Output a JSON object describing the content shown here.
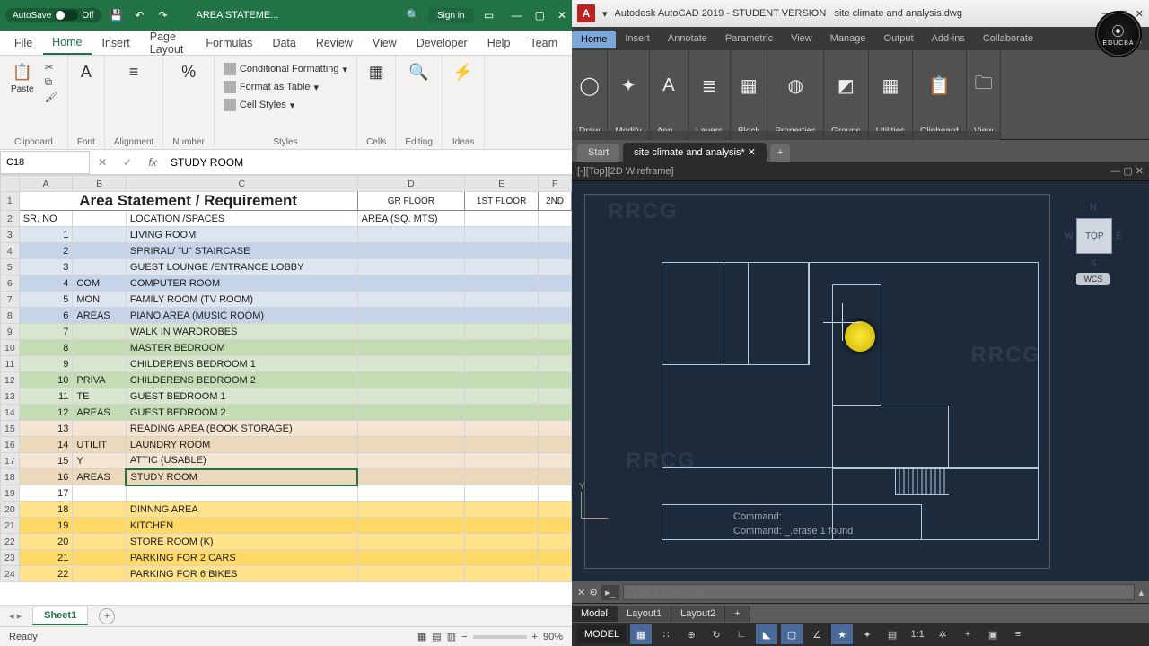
{
  "excel": {
    "titlebar": {
      "autosave_label": "AutoSave",
      "autosave_state": "Off",
      "doc_name": "AREA STATEME...",
      "signin": "Sign in"
    },
    "tabs": [
      "File",
      "Home",
      "Insert",
      "Page Layout",
      "Formulas",
      "Data",
      "Review",
      "View",
      "Developer",
      "Help",
      "Team"
    ],
    "active_tab": "Home",
    "ribbon_groups": {
      "clipboard": "Clipboard",
      "font": "Font",
      "alignment": "Alignment",
      "number": "Number",
      "styles": "Styles",
      "cells": "Cells",
      "editing": "Editing",
      "ideas": "Ideas"
    },
    "style_menu": {
      "cond": "Conditional Formatting",
      "table": "Format as Table",
      "cell": "Cell Styles"
    },
    "name_box": "C18",
    "formula_value": "STUDY ROOM",
    "columns": [
      "",
      "A",
      "B",
      "C",
      "D",
      "E",
      "F"
    ],
    "header_title": "Area Statement / Requirement",
    "floor_headers": [
      "GR FLOOR",
      "1ST FLOOR",
      "2ND"
    ],
    "col_labels": {
      "sr": "SR. NO",
      "loc": "LOCATION /SPACES",
      "area": "AREA (SQ. MTS)"
    },
    "rows": [
      {
        "r": 3,
        "sr": "1",
        "b": "",
        "c": "LIVING ROOM",
        "band": "blue"
      },
      {
        "r": 4,
        "sr": "2",
        "b": "",
        "c": "SPRIRAL/ \"U\" STAIRCASE",
        "band": "blue2"
      },
      {
        "r": 5,
        "sr": "3",
        "b": "",
        "c": "GUEST LOUNGE /ENTRANCE LOBBY",
        "band": "blue"
      },
      {
        "r": 6,
        "sr": "4",
        "b": "COM",
        "c": "COMPUTER ROOM",
        "band": "blue2"
      },
      {
        "r": 7,
        "sr": "5",
        "b": "MON",
        "c": "FAMILY ROOM (TV ROOM)",
        "band": "blue"
      },
      {
        "r": 8,
        "sr": "6",
        "b": "AREAS",
        "c": "PIANO AREA (MUSIC ROOM)",
        "band": "blue2"
      },
      {
        "r": 9,
        "sr": "7",
        "b": "",
        "c": "WALK IN WARDROBES",
        "band": "green"
      },
      {
        "r": 10,
        "sr": "8",
        "b": "",
        "c": "MASTER BEDROOM",
        "band": "green2"
      },
      {
        "r": 11,
        "sr": "9",
        "b": "",
        "c": "CHILDERENS BEDROOM 1",
        "band": "green"
      },
      {
        "r": 12,
        "sr": "10",
        "b": "PRIVA",
        "c": "CHILDERENS BEDROOM 2",
        "band": "green2"
      },
      {
        "r": 13,
        "sr": "11",
        "b": "TE",
        "c": "GUEST BEDROOM 1",
        "band": "green"
      },
      {
        "r": 14,
        "sr": "12",
        "b": "AREAS",
        "c": "GUEST BEDROOM 2",
        "band": "green2"
      },
      {
        "r": 15,
        "sr": "13",
        "b": "",
        "c": "READING AREA (BOOK STORAGE)",
        "band": "tan"
      },
      {
        "r": 16,
        "sr": "14",
        "b": "UTILIT",
        "c": "LAUNDRY ROOM",
        "band": "tan2"
      },
      {
        "r": 17,
        "sr": "15",
        "b": "Y",
        "c": "ATTIC (USABLE)",
        "band": "tan"
      },
      {
        "r": 18,
        "sr": "16",
        "b": "AREAS",
        "c": "STUDY ROOM",
        "band": "tan2",
        "sel": true
      },
      {
        "r": 19,
        "sr": "17",
        "b": "",
        "c": "",
        "band": ""
      },
      {
        "r": 20,
        "sr": "18",
        "b": "",
        "c": "DINNNG AREA",
        "band": "yellow"
      },
      {
        "r": 21,
        "sr": "19",
        "b": "",
        "c": "KITCHEN",
        "band": "yellow2"
      },
      {
        "r": 22,
        "sr": "20",
        "b": "",
        "c": "STORE ROOM (K)",
        "band": "yellow"
      },
      {
        "r": 23,
        "sr": "21",
        "b": "",
        "c": "PARKING FOR 2 CARS",
        "band": "yellow2"
      },
      {
        "r": 24,
        "sr": "22",
        "b": "",
        "c": "PARKING FOR 6 BIKES",
        "band": "yellow"
      }
    ],
    "sheet_tab": "Sheet1",
    "status": "Ready",
    "zoom": "90%"
  },
  "acad": {
    "title": "Autodesk AutoCAD 2019 - STUDENT VERSION",
    "filename": "site climate and analysis.dwg",
    "menu": [
      "Home",
      "Insert",
      "Annotate",
      "Parametric",
      "View",
      "Manage",
      "Output",
      "Add-ins",
      "Collaborate"
    ],
    "active_menu": "Home",
    "ribbon": [
      {
        "label": "Draw",
        "icon": "◯"
      },
      {
        "label": "Modify",
        "icon": "✦"
      },
      {
        "label": "Ann...",
        "icon": "A"
      },
      {
        "label": "Layers",
        "icon": "≣"
      },
      {
        "label": "Block",
        "icon": "▦"
      },
      {
        "label": "Properties",
        "icon": "◍"
      },
      {
        "label": "Groups",
        "icon": "◩",
        "sub": "Groups"
      },
      {
        "label": "Utilities",
        "icon": "▦"
      },
      {
        "label": "Clipboard",
        "icon": "📋"
      },
      {
        "label": "View",
        "icon": "🗀"
      }
    ],
    "file_tabs": [
      {
        "label": "Start",
        "active": false
      },
      {
        "label": "site climate and analysis*",
        "active": true
      }
    ],
    "viewport_label": "[-][Top][2D Wireframe]",
    "cmd_lines": [
      "Command:",
      "Command: _.erase 1 found"
    ],
    "cmd_placeholder": "Type a command",
    "layout_tabs": [
      "Model",
      "Layout1",
      "Layout2"
    ],
    "active_layout": "Model",
    "status_model": "MODEL",
    "viewcube": {
      "top": "TOP",
      "n": "N",
      "s": "S",
      "e": "E",
      "w": "W",
      "wcs": "WCS"
    }
  },
  "watermark": "RRCG",
  "educba": "EDUCBA"
}
